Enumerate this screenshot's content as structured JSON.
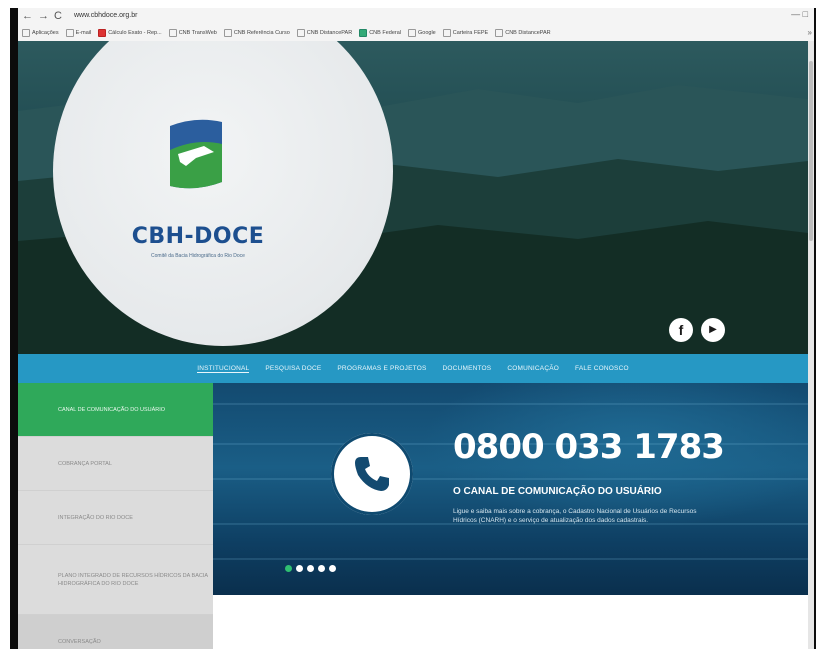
{
  "browser": {
    "back": "←",
    "forward": "→",
    "reload": "C",
    "url": "www.cbhdoce.org.br",
    "window_controls": "— □",
    "bookmarks": [
      {
        "label": "Aplicações",
        "icon": "apps-grid-icon"
      },
      {
        "label": "E-mail",
        "icon": "mail-icon"
      },
      {
        "label": "Cálculo Exato - Rep...",
        "icon": "calc-icon"
      },
      {
        "label": "CNB TransWeb",
        "icon": "page-icon"
      },
      {
        "label": "CNB Referência Curso",
        "icon": "page-icon"
      },
      {
        "label": "CNB DistancePAR",
        "icon": "page-icon"
      },
      {
        "label": "CNB Federal",
        "icon": "page-icon"
      },
      {
        "label": "Google",
        "icon": "page-icon"
      },
      {
        "label": "Carteira FEPE",
        "icon": "page-icon"
      },
      {
        "label": "CNB DistancePAR",
        "icon": "page-icon"
      }
    ],
    "bookmarks_more": "»"
  },
  "header": {
    "logo_title": "CBH-DOCE",
    "logo_subtitle": "Comitê da Bacia Hidrográfica do Rio Doce",
    "social": {
      "facebook": "f",
      "youtube": "▶"
    }
  },
  "nav": {
    "items": [
      "Institucional",
      "Pesquisa Doce",
      "Programas e Projetos",
      "Documentos",
      "Comunicação",
      "Fale Conosco"
    ]
  },
  "sidebar": {
    "items": [
      "Canal de Comunicação do Usuário",
      "Cobrança Portal",
      "Integração do Rio Doce",
      "Plano Integrado de Recursos Hídricos da Bacia Hidrográfica do Rio Doce",
      "Conversação"
    ]
  },
  "banner": {
    "phone_number": "0800 033 1783",
    "headline": "O CANAL DE COMUNICAÇÃO DO USUÁRIO",
    "body": "Ligue e saiba mais sobre a cobrança, o Cadastro Nacional de Usuários de Recursos Hídricos (CNARH) e o serviço de atualização dos dados cadastrais.",
    "slides_total": 5,
    "slide_active_index": 0
  },
  "colors": {
    "nav_bg": "#2698c4",
    "sidebar_active": "#2fa95a",
    "logo_text": "#1d4f8f"
  }
}
